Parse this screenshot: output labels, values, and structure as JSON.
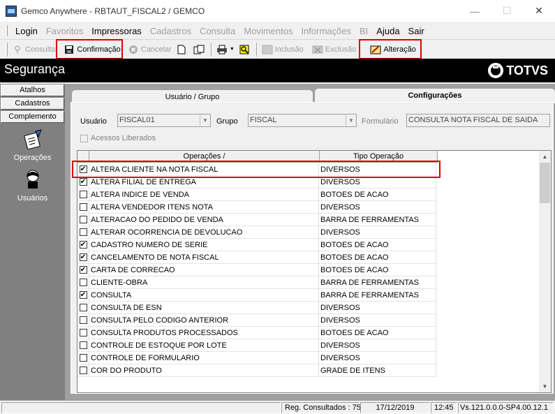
{
  "window": {
    "title": "Gemco Anywhere - RBTAUT_FISCAL2 / GEMCO",
    "minimize": "—",
    "maximize": "☐",
    "close": "✕"
  },
  "menu": [
    {
      "label": "Login",
      "enabled": true
    },
    {
      "label": "Favoritos",
      "enabled": false
    },
    {
      "label": "Impressoras",
      "enabled": true
    },
    {
      "label": "Cadastros",
      "enabled": false
    },
    {
      "label": "Consulta",
      "enabled": false
    },
    {
      "label": "Movimentos",
      "enabled": false
    },
    {
      "label": "Informações",
      "enabled": false
    },
    {
      "label": "BI",
      "enabled": false
    },
    {
      "label": "Ajuda",
      "enabled": true
    },
    {
      "label": "Sair",
      "enabled": true
    }
  ],
  "toolbar": {
    "consulta": "Consulta",
    "confirmacao": "Confirmação",
    "cancelar": "Cancelar",
    "inclusao": "Inclusão",
    "exclusao": "Exclusão",
    "alteracao": "Alteração"
  },
  "header": {
    "title": "Segurança",
    "brand": "TOTVS"
  },
  "left": {
    "atalhos": "Atalhos",
    "cadastros": "Cadastros",
    "complemento": "Complemento",
    "operacoes": "Operações",
    "usuarios": "Usuários"
  },
  "tabs": {
    "usuario_grupo": "Usuário  / Grupo",
    "configuracoes": "Configurações"
  },
  "form": {
    "usuario_label": "Usuário",
    "usuario_value": "FISCAL01",
    "grupo_label": "Grupo",
    "grupo_value": "FISCAL",
    "formulario_label": "Formulário",
    "formulario_value": "CONSULTA NOTA FISCAL DE SAIDA",
    "acessos_label": "Acessos Liberados"
  },
  "grid": {
    "col_operacoes": "Operações  /",
    "col_tipo": "Tipo Operação",
    "rows": [
      {
        "op": "ALTERA CLIENTE NA NOTA FISCAL",
        "tipo": "DIVERSOS",
        "checked": true
      },
      {
        "op": "ALTERA FILIAL DE ENTREGA",
        "tipo": "DIVERSOS",
        "checked": true
      },
      {
        "op": "ALTERA INDICE DE VENDA",
        "tipo": "BOTOES DE ACAO",
        "checked": false
      },
      {
        "op": "ALTERA VENDEDOR ITENS NOTA",
        "tipo": "DIVERSOS",
        "checked": false
      },
      {
        "op": "ALTERACAO DO PEDIDO DE VENDA",
        "tipo": "BARRA DE FERRAMENTAS",
        "checked": false
      },
      {
        "op": "ALTERAR OCORRENCIA DE DEVOLUCAO",
        "tipo": "DIVERSOS",
        "checked": false
      },
      {
        "op": "CADASTRO NUMERO DE SERIE",
        "tipo": "BOTOES DE ACAO",
        "checked": true
      },
      {
        "op": "CANCELAMENTO DE NOTA FISCAL",
        "tipo": "BOTOES DE ACAO",
        "checked": true
      },
      {
        "op": "CARTA DE CORRECAO",
        "tipo": "BOTOES DE ACAO",
        "checked": true
      },
      {
        "op": "CLIENTE-OBRA",
        "tipo": "BARRA DE FERRAMENTAS",
        "checked": false
      },
      {
        "op": "CONSULTA",
        "tipo": "BARRA DE FERRAMENTAS",
        "checked": true
      },
      {
        "op": "CONSULTA DE ESN",
        "tipo": "DIVERSOS",
        "checked": false
      },
      {
        "op": "CONSULTA PELO CODIGO ANTERIOR",
        "tipo": "DIVERSOS",
        "checked": false
      },
      {
        "op": "CONSULTA PRODUTOS PROCESSADOS",
        "tipo": "BOTOES DE ACAO",
        "checked": false
      },
      {
        "op": "CONTROLE DE ESTOQUE POR LOTE",
        "tipo": "DIVERSOS",
        "checked": false
      },
      {
        "op": "CONTROLE DE FORMULARIO",
        "tipo": "DIVERSOS",
        "checked": false
      },
      {
        "op": "COR DO PRODUTO",
        "tipo": "GRADE DE ITENS",
        "checked": false
      }
    ]
  },
  "status": {
    "reg": "Reg. Consultados : 75",
    "date": "17/12/2019",
    "time": "12:45",
    "version": "Vs.121.0.0.0-SP4.00.12.1"
  },
  "colors": {
    "highlight": "#e00000",
    "header_bg": "#000000"
  }
}
